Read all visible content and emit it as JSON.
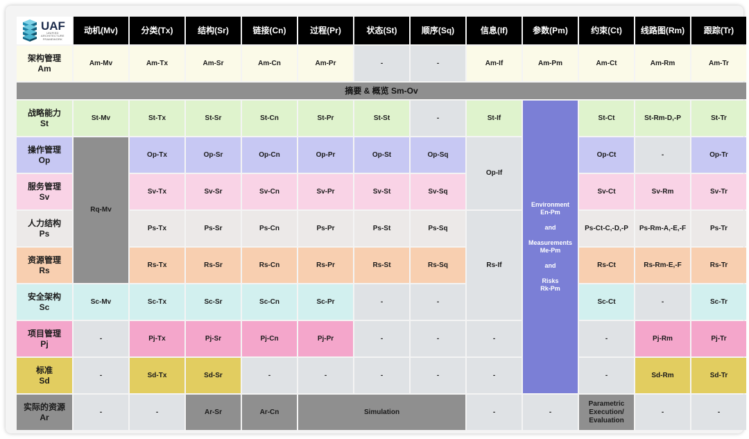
{
  "colors": {
    "header": "#000000",
    "banner": "#8f8f8f",
    "am": "#fbfae8",
    "st": "#dff3cd",
    "op": "#c7c8f3",
    "sv": "#f9d3e6",
    "ps": "#ece9e8",
    "rs": "#f8cfb0",
    "sc": "#d2f0ef",
    "pj": "#f4a6cb",
    "sd": "#e2cd60",
    "ar": "#8f8f8f",
    "empty": "#dfe2e5",
    "rq": "#8f8f8f",
    "param": "#7b7fd6"
  },
  "logo": {
    "title": "UAF",
    "subtitle": "UNIFIED\nARCHITECTURE\nFRAMEWORK"
  },
  "columns": [
    "动机(Mv)",
    "分类(Tx)",
    "结构(Sr)",
    "链接(Cn)",
    "过程(Pr)",
    "状态(St)",
    "顺序(Sq)",
    "信息(If)",
    "参数(Pm)",
    "约束(Ct)",
    "线路图(Rm)",
    "跟踪(Tr)"
  ],
  "rows": [
    {
      "zh": "架构管理",
      "code": "Am",
      "color": "am"
    },
    {
      "zh": "战略能力",
      "code": "St",
      "color": "st"
    },
    {
      "zh": "操作管理",
      "code": "Op",
      "color": "op"
    },
    {
      "zh": "服务管理",
      "code": "Sv",
      "color": "sv"
    },
    {
      "zh": "人力结构",
      "code": "Ps",
      "color": "ps"
    },
    {
      "zh": "资源管理",
      "code": "Rs",
      "color": "rs"
    },
    {
      "zh": "安全架构",
      "code": "Sc",
      "color": "sc"
    },
    {
      "zh": "项目管理",
      "code": "Pj",
      "color": "pj"
    },
    {
      "zh": "标准",
      "code": "Sd",
      "color": "sd"
    },
    {
      "zh": "实际的资源",
      "code": "Ar",
      "color": "ar"
    }
  ],
  "banner": "摘要 & 概览  Sm-Ov",
  "cells": [
    {
      "row": 2,
      "col": 2,
      "rs": 1,
      "cs": 1,
      "text": "Am-Mv",
      "color": "am"
    },
    {
      "row": 2,
      "col": 3,
      "rs": 1,
      "cs": 1,
      "text": "Am-Tx",
      "color": "am"
    },
    {
      "row": 2,
      "col": 4,
      "rs": 1,
      "cs": 1,
      "text": "Am-Sr",
      "color": "am"
    },
    {
      "row": 2,
      "col": 5,
      "rs": 1,
      "cs": 1,
      "text": "Am-Cn",
      "color": "am"
    },
    {
      "row": 2,
      "col": 6,
      "rs": 1,
      "cs": 1,
      "text": "Am-Pr",
      "color": "am"
    },
    {
      "row": 2,
      "col": 7,
      "rs": 1,
      "cs": 1,
      "text": "-",
      "color": "empty"
    },
    {
      "row": 2,
      "col": 8,
      "rs": 1,
      "cs": 1,
      "text": "-",
      "color": "empty"
    },
    {
      "row": 2,
      "col": 9,
      "rs": 1,
      "cs": 1,
      "text": "Am-If",
      "color": "am"
    },
    {
      "row": 2,
      "col": 10,
      "rs": 1,
      "cs": 1,
      "text": "Am-Pm",
      "color": "am"
    },
    {
      "row": 2,
      "col": 11,
      "rs": 1,
      "cs": 1,
      "text": "Am-Ct",
      "color": "am"
    },
    {
      "row": 2,
      "col": 12,
      "rs": 1,
      "cs": 1,
      "text": "Am-Rm",
      "color": "am"
    },
    {
      "row": 2,
      "col": 13,
      "rs": 1,
      "cs": 1,
      "text": "Am-Tr",
      "color": "am"
    },
    {
      "row": 4,
      "col": 2,
      "rs": 1,
      "cs": 1,
      "text": "St-Mv",
      "color": "st"
    },
    {
      "row": 4,
      "col": 3,
      "rs": 1,
      "cs": 1,
      "text": "St-Tx",
      "color": "st"
    },
    {
      "row": 4,
      "col": 4,
      "rs": 1,
      "cs": 1,
      "text": "St-Sr",
      "color": "st"
    },
    {
      "row": 4,
      "col": 5,
      "rs": 1,
      "cs": 1,
      "text": "St-Cn",
      "color": "st"
    },
    {
      "row": 4,
      "col": 6,
      "rs": 1,
      "cs": 1,
      "text": "St-Pr",
      "color": "st"
    },
    {
      "row": 4,
      "col": 7,
      "rs": 1,
      "cs": 1,
      "text": "St-St",
      "color": "st"
    },
    {
      "row": 4,
      "col": 8,
      "rs": 1,
      "cs": 1,
      "text": "-",
      "color": "empty"
    },
    {
      "row": 4,
      "col": 9,
      "rs": 1,
      "cs": 1,
      "text": "St-If",
      "color": "st"
    },
    {
      "row": 4,
      "col": 11,
      "rs": 1,
      "cs": 1,
      "text": "St-Ct",
      "color": "st"
    },
    {
      "row": 4,
      "col": 12,
      "rs": 1,
      "cs": 1,
      "text": "St-Rm-D,-P",
      "color": "st"
    },
    {
      "row": 4,
      "col": 13,
      "rs": 1,
      "cs": 1,
      "text": "St-Tr",
      "color": "st"
    },
    {
      "row": 5,
      "col": 2,
      "rs": 4,
      "cs": 1,
      "text": "Rq-Mv",
      "color": "rq"
    },
    {
      "row": 5,
      "col": 3,
      "rs": 1,
      "cs": 1,
      "text": "Op-Tx",
      "color": "op"
    },
    {
      "row": 5,
      "col": 4,
      "rs": 1,
      "cs": 1,
      "text": "Op-Sr",
      "color": "op"
    },
    {
      "row": 5,
      "col": 5,
      "rs": 1,
      "cs": 1,
      "text": "Op-Cn",
      "color": "op"
    },
    {
      "row": 5,
      "col": 6,
      "rs": 1,
      "cs": 1,
      "text": "Op-Pr",
      "color": "op"
    },
    {
      "row": 5,
      "col": 7,
      "rs": 1,
      "cs": 1,
      "text": "Op-St",
      "color": "op"
    },
    {
      "row": 5,
      "col": 8,
      "rs": 1,
      "cs": 1,
      "text": "Op-Sq",
      "color": "op"
    },
    {
      "row": 5,
      "col": 9,
      "rs": 2,
      "cs": 1,
      "text": "Op-If",
      "color": "empty"
    },
    {
      "row": 5,
      "col": 11,
      "rs": 1,
      "cs": 1,
      "text": "Op-Ct",
      "color": "op"
    },
    {
      "row": 5,
      "col": 12,
      "rs": 1,
      "cs": 1,
      "text": "-",
      "color": "empty"
    },
    {
      "row": 5,
      "col": 13,
      "rs": 1,
      "cs": 1,
      "text": "Op-Tr",
      "color": "op"
    },
    {
      "row": 6,
      "col": 3,
      "rs": 1,
      "cs": 1,
      "text": "Sv-Tx",
      "color": "sv"
    },
    {
      "row": 6,
      "col": 4,
      "rs": 1,
      "cs": 1,
      "text": "Sv-Sr",
      "color": "sv"
    },
    {
      "row": 6,
      "col": 5,
      "rs": 1,
      "cs": 1,
      "text": "Sv-Cn",
      "color": "sv"
    },
    {
      "row": 6,
      "col": 6,
      "rs": 1,
      "cs": 1,
      "text": "Sv-Pr",
      "color": "sv"
    },
    {
      "row": 6,
      "col": 7,
      "rs": 1,
      "cs": 1,
      "text": "Sv-St",
      "color": "sv"
    },
    {
      "row": 6,
      "col": 8,
      "rs": 1,
      "cs": 1,
      "text": "Sv-Sq",
      "color": "sv"
    },
    {
      "row": 6,
      "col": 11,
      "rs": 1,
      "cs": 1,
      "text": "Sv-Ct",
      "color": "sv"
    },
    {
      "row": 6,
      "col": 12,
      "rs": 1,
      "cs": 1,
      "text": "Sv-Rm",
      "color": "sv"
    },
    {
      "row": 6,
      "col": 13,
      "rs": 1,
      "cs": 1,
      "text": "Sv-Tr",
      "color": "sv"
    },
    {
      "row": 7,
      "col": 3,
      "rs": 1,
      "cs": 1,
      "text": "Ps-Tx",
      "color": "ps"
    },
    {
      "row": 7,
      "col": 4,
      "rs": 1,
      "cs": 1,
      "text": "Ps-Sr",
      "color": "ps"
    },
    {
      "row": 7,
      "col": 5,
      "rs": 1,
      "cs": 1,
      "text": "Ps-Cn",
      "color": "ps"
    },
    {
      "row": 7,
      "col": 6,
      "rs": 1,
      "cs": 1,
      "text": "Ps-Pr",
      "color": "ps"
    },
    {
      "row": 7,
      "col": 7,
      "rs": 1,
      "cs": 1,
      "text": "Ps-St",
      "color": "ps"
    },
    {
      "row": 7,
      "col": 8,
      "rs": 1,
      "cs": 1,
      "text": "Ps-Sq",
      "color": "ps"
    },
    {
      "row": 7,
      "col": 9,
      "rs": 3,
      "cs": 1,
      "text": "Rs-If",
      "color": "empty"
    },
    {
      "row": 7,
      "col": 11,
      "rs": 1,
      "cs": 1,
      "text": "Ps-Ct-C,-D,-P",
      "color": "ps"
    },
    {
      "row": 7,
      "col": 12,
      "rs": 1,
      "cs": 1,
      "text": "Ps-Rm-A,-E,-F",
      "color": "ps"
    },
    {
      "row": 7,
      "col": 13,
      "rs": 1,
      "cs": 1,
      "text": "Ps-Tr",
      "color": "ps"
    },
    {
      "row": 8,
      "col": 3,
      "rs": 1,
      "cs": 1,
      "text": "Rs-Tx",
      "color": "rs"
    },
    {
      "row": 8,
      "col": 4,
      "rs": 1,
      "cs": 1,
      "text": "Rs-Sr",
      "color": "rs"
    },
    {
      "row": 8,
      "col": 5,
      "rs": 1,
      "cs": 1,
      "text": "Rs-Cn",
      "color": "rs"
    },
    {
      "row": 8,
      "col": 6,
      "rs": 1,
      "cs": 1,
      "text": "Rs-Pr",
      "color": "rs"
    },
    {
      "row": 8,
      "col": 7,
      "rs": 1,
      "cs": 1,
      "text": "Rs-St",
      "color": "rs"
    },
    {
      "row": 8,
      "col": 8,
      "rs": 1,
      "cs": 1,
      "text": "Rs-Sq",
      "color": "rs"
    },
    {
      "row": 8,
      "col": 11,
      "rs": 1,
      "cs": 1,
      "text": "Rs-Ct",
      "color": "rs"
    },
    {
      "row": 8,
      "col": 12,
      "rs": 1,
      "cs": 1,
      "text": "Rs-Rm-E,-F",
      "color": "rs"
    },
    {
      "row": 8,
      "col": 13,
      "rs": 1,
      "cs": 1,
      "text": "Rs-Tr",
      "color": "rs"
    },
    {
      "row": 9,
      "col": 2,
      "rs": 1,
      "cs": 1,
      "text": "Sc-Mv",
      "color": "sc"
    },
    {
      "row": 9,
      "col": 3,
      "rs": 1,
      "cs": 1,
      "text": "Sc-Tx",
      "color": "sc"
    },
    {
      "row": 9,
      "col": 4,
      "rs": 1,
      "cs": 1,
      "text": "Sc-Sr",
      "color": "sc"
    },
    {
      "row": 9,
      "col": 5,
      "rs": 1,
      "cs": 1,
      "text": "Sc-Cn",
      "color": "sc"
    },
    {
      "row": 9,
      "col": 6,
      "rs": 1,
      "cs": 1,
      "text": "Sc-Pr",
      "color": "sc"
    },
    {
      "row": 9,
      "col": 7,
      "rs": 1,
      "cs": 1,
      "text": "-",
      "color": "empty"
    },
    {
      "row": 9,
      "col": 8,
      "rs": 1,
      "cs": 1,
      "text": "-",
      "color": "empty"
    },
    {
      "row": 9,
      "col": 11,
      "rs": 1,
      "cs": 1,
      "text": "Sc-Ct",
      "color": "sc"
    },
    {
      "row": 9,
      "col": 12,
      "rs": 1,
      "cs": 1,
      "text": "-",
      "color": "empty"
    },
    {
      "row": 9,
      "col": 13,
      "rs": 1,
      "cs": 1,
      "text": "Sc-Tr",
      "color": "sc"
    },
    {
      "row": 10,
      "col": 2,
      "rs": 1,
      "cs": 1,
      "text": "-",
      "color": "empty"
    },
    {
      "row": 10,
      "col": 3,
      "rs": 1,
      "cs": 1,
      "text": "Pj-Tx",
      "color": "pj"
    },
    {
      "row": 10,
      "col": 4,
      "rs": 1,
      "cs": 1,
      "text": "Pj-Sr",
      "color": "pj"
    },
    {
      "row": 10,
      "col": 5,
      "rs": 1,
      "cs": 1,
      "text": "Pj-Cn",
      "color": "pj"
    },
    {
      "row": 10,
      "col": 6,
      "rs": 1,
      "cs": 1,
      "text": "Pj-Pr",
      "color": "pj"
    },
    {
      "row": 10,
      "col": 7,
      "rs": 1,
      "cs": 1,
      "text": "-",
      "color": "empty"
    },
    {
      "row": 10,
      "col": 8,
      "rs": 1,
      "cs": 1,
      "text": "-",
      "color": "empty"
    },
    {
      "row": 10,
      "col": 9,
      "rs": 1,
      "cs": 1,
      "text": "-",
      "color": "empty"
    },
    {
      "row": 10,
      "col": 11,
      "rs": 1,
      "cs": 1,
      "text": "-",
      "color": "empty"
    },
    {
      "row": 10,
      "col": 12,
      "rs": 1,
      "cs": 1,
      "text": "Pj-Rm",
      "color": "pj"
    },
    {
      "row": 10,
      "col": 13,
      "rs": 1,
      "cs": 1,
      "text": "Pj-Tr",
      "color": "pj"
    },
    {
      "row": 11,
      "col": 2,
      "rs": 1,
      "cs": 1,
      "text": "-",
      "color": "empty"
    },
    {
      "row": 11,
      "col": 3,
      "rs": 1,
      "cs": 1,
      "text": "Sd-Tx",
      "color": "sd"
    },
    {
      "row": 11,
      "col": 4,
      "rs": 1,
      "cs": 1,
      "text": "Sd-Sr",
      "color": "sd"
    },
    {
      "row": 11,
      "col": 5,
      "rs": 1,
      "cs": 1,
      "text": "-",
      "color": "empty"
    },
    {
      "row": 11,
      "col": 6,
      "rs": 1,
      "cs": 1,
      "text": "-",
      "color": "empty"
    },
    {
      "row": 11,
      "col": 7,
      "rs": 1,
      "cs": 1,
      "text": "-",
      "color": "empty"
    },
    {
      "row": 11,
      "col": 8,
      "rs": 1,
      "cs": 1,
      "text": "-",
      "color": "empty"
    },
    {
      "row": 11,
      "col": 9,
      "rs": 1,
      "cs": 1,
      "text": "-",
      "color": "empty"
    },
    {
      "row": 11,
      "col": 11,
      "rs": 1,
      "cs": 1,
      "text": "-",
      "color": "empty"
    },
    {
      "row": 11,
      "col": 12,
      "rs": 1,
      "cs": 1,
      "text": "Sd-Rm",
      "color": "sd"
    },
    {
      "row": 11,
      "col": 13,
      "rs": 1,
      "cs": 1,
      "text": "Sd-Tr",
      "color": "sd"
    },
    {
      "row": 12,
      "col": 2,
      "rs": 1,
      "cs": 1,
      "text": "-",
      "color": "empty"
    },
    {
      "row": 12,
      "col": 3,
      "rs": 1,
      "cs": 1,
      "text": "-",
      "color": "empty"
    },
    {
      "row": 12,
      "col": 4,
      "rs": 1,
      "cs": 1,
      "text": "Ar-Sr",
      "color": "ar"
    },
    {
      "row": 12,
      "col": 5,
      "rs": 1,
      "cs": 1,
      "text": "Ar-Cn",
      "color": "ar"
    },
    {
      "row": 12,
      "col": 6,
      "rs": 1,
      "cs": 3,
      "text": "Simulation",
      "color": "ar"
    },
    {
      "row": 12,
      "col": 9,
      "rs": 1,
      "cs": 1,
      "text": "-",
      "color": "empty"
    },
    {
      "row": 12,
      "col": 10,
      "rs": 1,
      "cs": 1,
      "text": "-",
      "color": "empty"
    },
    {
      "row": 12,
      "col": 11,
      "rs": 1,
      "cs": 1,
      "text": "Parametric\nExecution/\nEvaluation",
      "color": "ar"
    },
    {
      "row": 12,
      "col": 12,
      "rs": 1,
      "cs": 1,
      "text": "-",
      "color": "empty"
    },
    {
      "row": 12,
      "col": 13,
      "rs": 1,
      "cs": 1,
      "text": "-",
      "color": "empty"
    }
  ],
  "parametric": {
    "lines": [
      "Environment",
      "En-Pm",
      "",
      "and",
      "",
      "Measurements",
      "Me-Pm",
      "",
      "and",
      "",
      "Risks",
      "Rk-Pm"
    ]
  }
}
